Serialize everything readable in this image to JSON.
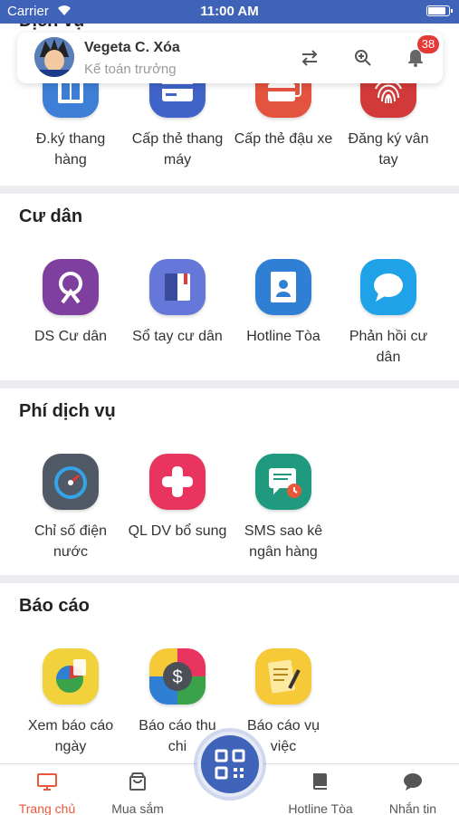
{
  "status_bar": {
    "carrier": "Carrier",
    "time": "11:00 AM"
  },
  "profile": {
    "name": "Vegeta C. Xóa",
    "role": "Kế toán trưởng",
    "notification_count": "38",
    "icons": [
      "swap-icon",
      "zoom-in-icon",
      "bell-icon"
    ]
  },
  "sections": {
    "dich_vu": {
      "title": "Dịch vụ",
      "items": [
        {
          "label": "Đ.ký thang hàng",
          "icon": "elevator-goods-icon",
          "color": "#3d7fd6"
        },
        {
          "label": "Cấp thẻ thang máy",
          "icon": "elevator-card-icon",
          "color": "#3f63c8"
        },
        {
          "label": "Cấp thẻ đậu xe",
          "icon": "parking-card-icon",
          "color": "#e4533f"
        },
        {
          "label": "Đăng ký vân tay",
          "icon": "fingerprint-icon",
          "color": "#d23a3a"
        }
      ]
    },
    "cu_dan": {
      "title": "Cư dân",
      "items": [
        {
          "label": "DS Cư dân",
          "icon": "resident-list-icon",
          "color": "#7e3f9f"
        },
        {
          "label": "Sổ tay cư dân",
          "icon": "handbook-icon",
          "color": "#6577d8"
        },
        {
          "label": "Hotline Tòa",
          "icon": "hotline-icon",
          "color": "#2f7fd4"
        },
        {
          "label": "Phản hồi cư dân",
          "icon": "feedback-icon",
          "color": "#1fa2e8"
        }
      ]
    },
    "phi_dich_vu": {
      "title": "Phí dịch vụ",
      "items": [
        {
          "label": "Chỉ số điện nước",
          "icon": "meter-icon",
          "color": "#505a66"
        },
        {
          "label": "QL DV bổ sung",
          "icon": "add-service-icon",
          "color": "#e8345e"
        },
        {
          "label": "SMS sao kê ngân hàng",
          "icon": "sms-statement-icon",
          "color": "#1f9a7e"
        }
      ]
    },
    "bao_cao": {
      "title": "Báo cáo",
      "items": [
        {
          "label": "Xem báo cáo ngày",
          "icon": "daily-report-icon",
          "color": "#f2d23c"
        },
        {
          "label": "Báo cáo thu chi",
          "icon": "income-expense-icon",
          "color": "#4b4f57"
        },
        {
          "label": "Báo cáo vụ việc",
          "icon": "incident-report-icon",
          "color": "#f6c938"
        }
      ]
    }
  },
  "bottom_nav": {
    "items": [
      {
        "label": "Trang chủ",
        "icon": "home-monitor-icon"
      },
      {
        "label": "Mua sắm",
        "icon": "shopping-bag-icon"
      },
      {
        "label": "Hotline Tòa",
        "icon": "book-icon"
      },
      {
        "label": "Nhắn tin",
        "icon": "chat-icon"
      }
    ],
    "center_icon": "qr-code-icon"
  }
}
